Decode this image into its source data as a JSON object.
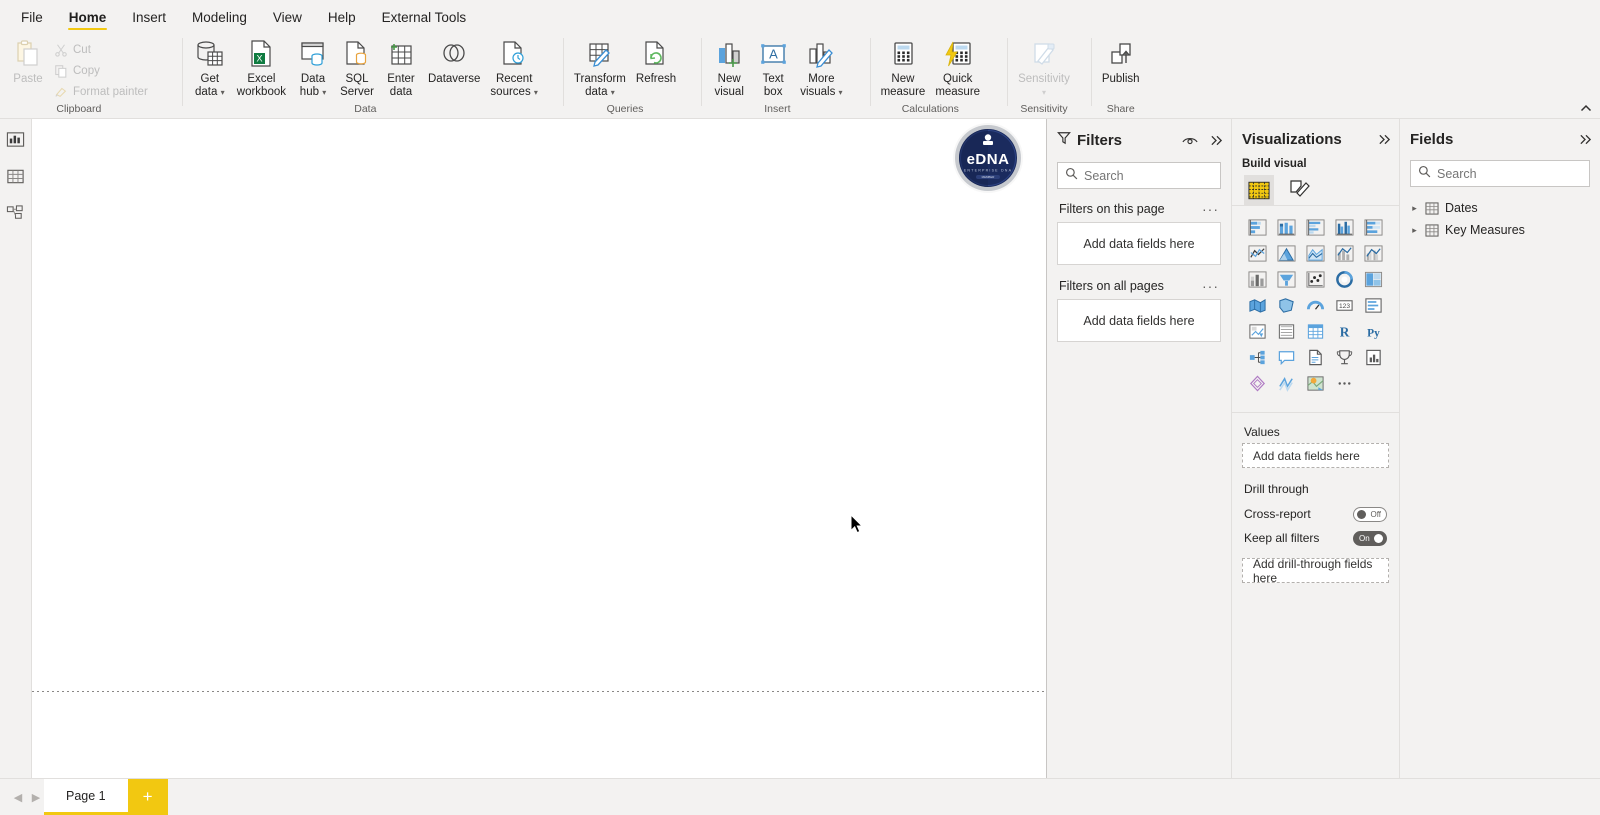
{
  "app": {
    "name": "Power BI Desktop",
    "accent": "#f2c811",
    "pane_bg": "#f3f2f1"
  },
  "ribbon": {
    "tabs": [
      {
        "label": "File",
        "active": false
      },
      {
        "label": "Home",
        "active": true
      },
      {
        "label": "Insert",
        "active": false
      },
      {
        "label": "Modeling",
        "active": false
      },
      {
        "label": "View",
        "active": false
      },
      {
        "label": "Help",
        "active": false
      },
      {
        "label": "External Tools",
        "active": false
      }
    ],
    "collapse_icon": "chevron-up-icon",
    "groups": [
      {
        "name": "Clipboard",
        "label": "Clipboard",
        "paste": {
          "label": "Paste",
          "icon": "paste-icon",
          "disabled": true
        },
        "items": [
          {
            "label": "Cut",
            "icon": "scissors-icon",
            "disabled": true
          },
          {
            "label": "Copy",
            "icon": "copy-icon",
            "disabled": true
          },
          {
            "label": "Format painter",
            "icon": "format-painter-icon",
            "disabled": true
          }
        ]
      },
      {
        "name": "Data",
        "label": "Data",
        "items": [
          {
            "label": "Get\ndata",
            "icon": "get-data-icon",
            "caret": true
          },
          {
            "label": "Excel\nworkbook",
            "icon": "excel-icon",
            "caret": false
          },
          {
            "label": "Data\nhub",
            "icon": "data-hub-icon",
            "caret": true
          },
          {
            "label": "SQL\nServer",
            "icon": "sql-server-icon",
            "caret": false
          },
          {
            "label": "Enter\ndata",
            "icon": "enter-data-icon",
            "caret": false
          },
          {
            "label": "Dataverse",
            "icon": "dataverse-icon",
            "caret": false
          },
          {
            "label": "Recent\nsources",
            "icon": "recent-sources-icon",
            "caret": true
          }
        ]
      },
      {
        "name": "Queries",
        "label": "Queries",
        "items": [
          {
            "label": "Transform\ndata",
            "icon": "transform-data-icon",
            "caret": true
          },
          {
            "label": "Refresh",
            "icon": "refresh-icon",
            "caret": false
          }
        ]
      },
      {
        "name": "Insert",
        "label": "Insert",
        "items": [
          {
            "label": "New\nvisual",
            "icon": "new-visual-icon",
            "caret": false
          },
          {
            "label": "Text\nbox",
            "icon": "text-box-icon",
            "caret": false
          },
          {
            "label": "More\nvisuals",
            "icon": "more-visuals-icon",
            "caret": true
          }
        ]
      },
      {
        "name": "Calculations",
        "label": "Calculations",
        "items": [
          {
            "label": "New\nmeasure",
            "icon": "new-measure-icon",
            "caret": false
          },
          {
            "label": "Quick\nmeasure",
            "icon": "quick-measure-icon",
            "caret": false
          }
        ]
      },
      {
        "name": "Sensitivity",
        "label": "Sensitivity",
        "items": [
          {
            "label": "Sensitivity",
            "icon": "sensitivity-icon",
            "caret": true,
            "disabled": true
          }
        ]
      },
      {
        "name": "Share",
        "label": "Share",
        "items": [
          {
            "label": "Publish",
            "icon": "publish-icon",
            "caret": false
          }
        ]
      }
    ]
  },
  "view_switcher": [
    {
      "name": "report-view",
      "icon": "report-view-icon",
      "selected": true
    },
    {
      "name": "data-view",
      "icon": "data-view-icon",
      "selected": false
    },
    {
      "name": "model-view",
      "icon": "model-view-icon",
      "selected": false
    }
  ],
  "canvas": {
    "logo_text": "eDNA",
    "logo_sub": "ENTERPRISE",
    "logo_colors": {
      "navy": "#1b2b5e",
      "dark": "#101c3d"
    }
  },
  "filters": {
    "title": "Filters",
    "filter_icon": "funnel-icon",
    "eye_icon": "eye-icon",
    "expand_icon": "chevrons-right-icon",
    "search": {
      "placeholder": "Search",
      "value": "",
      "icon": "search-icon"
    },
    "sections": [
      {
        "title": "Filters on this page",
        "dropzone": "Add data fields here",
        "more": "···"
      },
      {
        "title": "Filters on all pages",
        "dropzone": "Add data fields here",
        "more": "···"
      }
    ]
  },
  "visualizations": {
    "title": "Visualizations",
    "expand_icon": "chevrons-right-icon",
    "build_visual_label": "Build visual",
    "tabs": [
      {
        "name": "build-visual-tab",
        "icon": "fields-grid-icon",
        "selected": true
      },
      {
        "name": "format-visual-tab",
        "icon": "format-paintbrush-icon",
        "selected": false
      }
    ],
    "gallery": [
      "stacked-bar-chart-icon",
      "stacked-column-chart-icon",
      "clustered-bar-chart-icon",
      "clustered-column-chart-icon",
      "hundred-percent-stacked-bar-chart-icon",
      "line-chart-icon",
      "area-chart-icon",
      "stacked-area-chart-icon",
      "line-stacked-column-chart-icon",
      "line-clustered-column-chart-icon",
      "ribbon-chart-icon",
      "waterfall-chart-icon",
      "scatter-chart-icon",
      "pie-chart-icon",
      "treemap-icon",
      "map-icon",
      "filled-map-icon",
      "gauge-icon",
      "card-icon",
      "multi-row-card-icon",
      "kpi-icon",
      "slicer-icon",
      "table-icon",
      "matrix-icon",
      "r-script-visual-icon",
      "python-visual-icon",
      "key-influencers-icon",
      "decomposition-tree-icon",
      "qna-icon",
      "smart-narrative-icon",
      "paginated-report-icon",
      "get-more-visuals-icon",
      "power-apps-icon",
      "arcgis-maps-icon",
      "more-options-icon"
    ],
    "values_label": "Values",
    "values_dropzone": "Add data fields here",
    "drill_through_label": "Drill through",
    "toggles": [
      {
        "label": "Cross-report",
        "state": "Off",
        "on": false
      },
      {
        "label": "Keep all filters",
        "state": "On",
        "on": true
      }
    ],
    "drill_dropzone": "Add drill-through fields here"
  },
  "fields": {
    "title": "Fields",
    "expand_icon": "chevrons-right-icon",
    "search": {
      "placeholder": "Search",
      "value": "",
      "icon": "search-icon"
    },
    "tables": [
      {
        "label": "Dates",
        "icon": "table-icon",
        "expanded": false
      },
      {
        "label": "Key Measures",
        "icon": "table-icon",
        "expanded": false
      }
    ]
  },
  "statusbar": {
    "prev_icon": "chevron-left-icon",
    "next_icon": "chevron-right-icon",
    "pages": [
      {
        "label": "Page 1",
        "active": true
      }
    ],
    "add_page_label": "+"
  }
}
